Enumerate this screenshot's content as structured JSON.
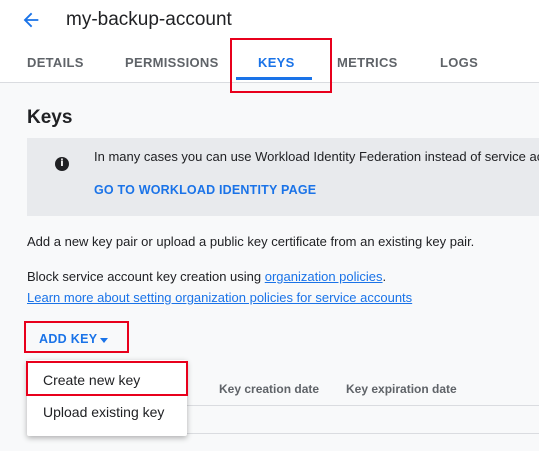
{
  "header": {
    "title": "my-backup-account",
    "back_icon": "arrow-back-icon"
  },
  "tabs": [
    {
      "label": "DETAILS"
    },
    {
      "label": "PERMISSIONS"
    },
    {
      "label": "KEYS",
      "active": true
    },
    {
      "label": "METRICS"
    },
    {
      "label": "LOGS"
    }
  ],
  "page": {
    "heading": "Keys",
    "info": {
      "icon": "info-icon",
      "text": "In many cases you can use Workload Identity Federation instead of service ac",
      "link": "GO TO WORKLOAD IDENTITY PAGE"
    },
    "add_key_text": "Add a new key pair or upload a public key certificate from an existing key pair.",
    "block_text": "Block service account key creation using ",
    "block_link": "organization policies",
    "block_suffix": ".",
    "learn_more": "Learn more about setting organization policies for service accounts"
  },
  "add_key_button": {
    "label": "ADD KEY",
    "icon": "caret-down-icon"
  },
  "menu": {
    "items": [
      {
        "label": "Create new key"
      },
      {
        "label": "Upload existing key"
      }
    ]
  },
  "table": {
    "columns": [
      "Key creation date",
      "Key expiration date"
    ]
  },
  "colors": {
    "accent": "#1a73e8",
    "highlight": "#e8001c",
    "text": "#202124"
  }
}
